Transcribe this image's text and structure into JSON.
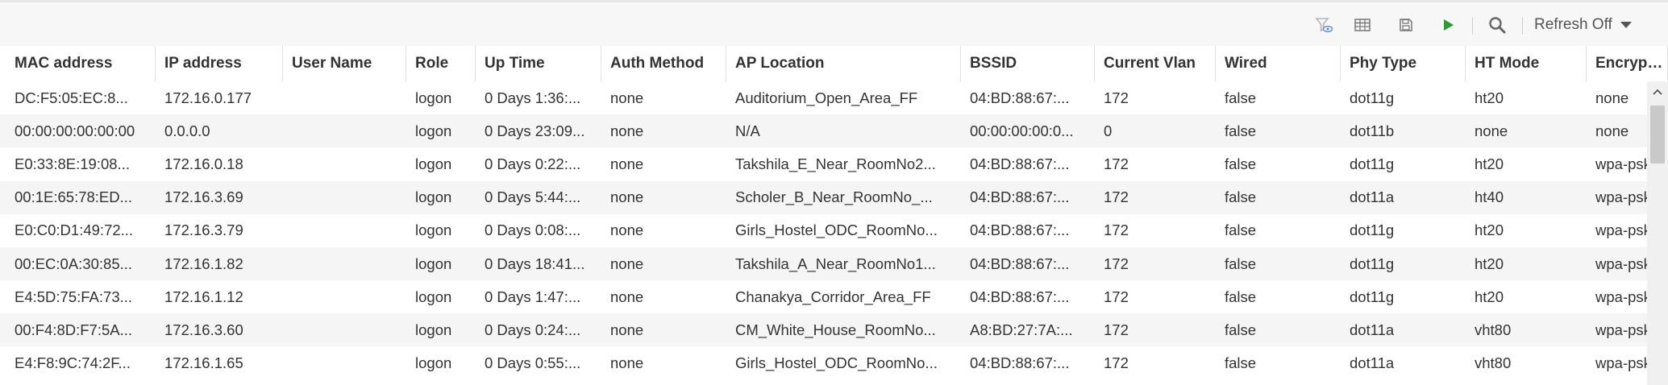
{
  "toolbar": {
    "icons": [
      "filter-visibility-icon",
      "columns-grid-icon",
      "save-disk-icon",
      "play-icon",
      "search-icon"
    ],
    "play_color": "#2a9d2a",
    "refresh_label": "Refresh Off"
  },
  "table": {
    "columns": [
      "MAC address",
      "IP address",
      "User Name",
      "Role",
      "Up Time",
      "Auth Method",
      "AP Location",
      "BSSID",
      "Current Vlan",
      "Wired",
      "Phy Type",
      "HT Mode",
      "Encryption"
    ],
    "rows": [
      [
        "DC:F5:05:EC:8...",
        "172.16.0.177",
        "",
        "logon",
        "0 Days 1:36:...",
        "none",
        "Auditorium_Open_Area_FF",
        "04:BD:88:67:...",
        "172",
        "false",
        "dot11g",
        "ht20",
        "none"
      ],
      [
        "00:00:00:00:00:00",
        "0.0.0.0",
        "",
        "logon",
        "0 Days 23:09...",
        "none",
        "N/A",
        "00:00:00:00:0...",
        "0",
        "false",
        "dot11b",
        "none",
        "none"
      ],
      [
        "E0:33:8E:19:08...",
        "172.16.0.18",
        "",
        "logon",
        "0 Days 0:22:...",
        "none",
        "Takshila_E_Near_RoomNo2...",
        "04:BD:88:67:...",
        "172",
        "false",
        "dot11g",
        "ht20",
        "wpa-psk"
      ],
      [
        "00:1E:65:78:ED...",
        "172.16.3.69",
        "",
        "logon",
        "0 Days 5:44:...",
        "none",
        "Scholer_B_Near_RoomNo_...",
        "04:BD:88:67:...",
        "172",
        "false",
        "dot11a",
        "ht40",
        "wpa-psk"
      ],
      [
        "E0:C0:D1:49:72...",
        "172.16.3.79",
        "",
        "logon",
        "0 Days 0:08:...",
        "none",
        "Girls_Hostel_ODC_RoomNo...",
        "04:BD:88:67:...",
        "172",
        "false",
        "dot11g",
        "ht20",
        "wpa-psk"
      ],
      [
        "00:EC:0A:30:85...",
        "172.16.1.82",
        "",
        "logon",
        "0 Days 18:41...",
        "none",
        "Takshila_A_Near_RoomNo1...",
        "04:BD:88:67:...",
        "172",
        "false",
        "dot11g",
        "ht20",
        "wpa-psk"
      ],
      [
        "E4:5D:75:FA:73...",
        "172.16.1.12",
        "",
        "logon",
        "0 Days 1:47:...",
        "none",
        "Chanakya_Corridor_Area_FF",
        "04:BD:88:67:...",
        "172",
        "false",
        "dot11g",
        "ht20",
        "wpa-psk"
      ],
      [
        "00:F4:8D:F7:5A...",
        "172.16.3.60",
        "",
        "logon",
        "0 Days 0:24:...",
        "none",
        "CM_White_House_RoomNo...",
        "A8:BD:27:7A:...",
        "172",
        "false",
        "dot11a",
        "vht80",
        "wpa-psk"
      ],
      [
        "E4:F8:9C:74:2F...",
        "172.16.1.65",
        "",
        "logon",
        "0 Days 0:55:...",
        "none",
        "Girls_Hostel_ODC_RoomNo...",
        "04:BD:88:67:...",
        "172",
        "false",
        "dot11a",
        "vht80",
        "wpa-psk"
      ]
    ]
  }
}
